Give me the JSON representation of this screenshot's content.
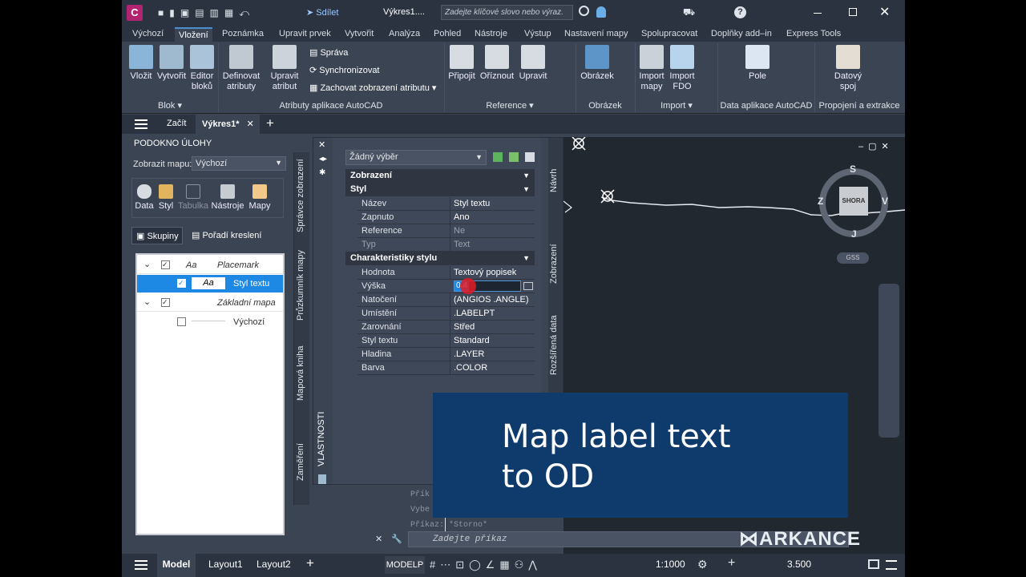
{
  "titlebar": {
    "app_letter": "C",
    "share_label": "Sdílet",
    "doc_title": "Výkres1....",
    "search_placeholder": "Zadejte klíčové slovo nebo výraz."
  },
  "ribbon_tabs": [
    "Výchozí",
    "Vložení",
    "Poznámka",
    "Upravit prvek",
    "Vytvořit",
    "Analýza",
    "Pohled",
    "Nástroje",
    "Výstup",
    "Nastavení mapy",
    "Spolupracovat",
    "Doplňky add–in",
    "Express Tools"
  ],
  "ribbon": {
    "blok": {
      "vlozit": "Vložit",
      "vytvorit": "Vytvořit",
      "editor": "Editor bloků",
      "label": "Blok"
    },
    "atributy": {
      "definovat": "Definovat atributy",
      "upravit": "Upravit atribut",
      "sprava": "Správa",
      "synchronizovat": "Synchronizovat",
      "zachovat": "Zachovat zobrazení atributu",
      "label": "Atributy aplikace AutoCAD"
    },
    "reference": {
      "pripojit": "Připojit",
      "oriznout": "Oříznout",
      "upravit": "Upravit",
      "label": "Reference"
    },
    "obrazek": {
      "obrazek": "Obrázek",
      "label": "Obrázek"
    },
    "import": {
      "import_mapy": "Import mapy",
      "import_fdo": "Import FDO",
      "label": "Import"
    },
    "data": {
      "pole": "Pole",
      "label": "Data aplikace AutoCAD"
    },
    "propojeni": {
      "spoj": "Datový spoj",
      "label": "Propojení a extrakce"
    }
  },
  "doc_tabs": {
    "zacit": "Začít",
    "active": "Výkres1*"
  },
  "task_pane": {
    "title": "PODOKNO ÚLOHY",
    "map_label": "Zobrazit mapu:",
    "map_value": "Výchozí",
    "tools": [
      "Data",
      "Styl",
      "Tabulka",
      "Nástroje",
      "Mapy"
    ],
    "skupiny": "Skupiny",
    "poradi": "Pořadí kreslení",
    "tree": [
      {
        "label": "Placemark",
        "sample": "Aa"
      },
      {
        "label": "Styl textu",
        "sample": "Aa"
      },
      {
        "label": "Základní mapa",
        "sample": ""
      },
      {
        "label": "Výchozí",
        "sample": ""
      }
    ],
    "side_tabs": [
      "Správce zobrazení",
      "Průzkumník mapy",
      "Mapová kniha",
      "Zaměření"
    ]
  },
  "properties": {
    "selection": "Žádný výběr",
    "vertical_title": "VLASTNOSTI",
    "sections": {
      "zobrazeni": "Zobrazení",
      "styl": "Styl",
      "charakteristiky": "Charakteristiky stylu"
    },
    "styl_rows": [
      {
        "k": "Název",
        "v": "Styl textu"
      },
      {
        "k": "Zapnuto",
        "v": "Ano"
      },
      {
        "k": "Reference",
        "v": "Ne"
      },
      {
        "k": "Typ",
        "v": "Text"
      }
    ],
    "char_rows": [
      {
        "k": "Hodnota",
        "v": "Textový popisek"
      },
      {
        "k": "Výška",
        "v": "0.4"
      },
      {
        "k": "Natočení",
        "v": "(ANGIOS .ANGLE)"
      },
      {
        "k": "Umístění",
        "v": ".LABELPT"
      },
      {
        "k": "Zarovnání",
        "v": "Střed"
      },
      {
        "k": "Styl textu",
        "v": "Standard"
      },
      {
        "k": "Hladina",
        "v": ".LAYER"
      },
      {
        "k": "Barva",
        "v": ".COLOR"
      }
    ],
    "right_tabs": [
      "Návrh",
      "Zobrazení",
      "Rozšířená data"
    ]
  },
  "canvas": {
    "compass": {
      "n": "S",
      "s": "J",
      "w": "Z",
      "e": "V",
      "cube": "SHORA",
      "gss": "GSS"
    }
  },
  "command": {
    "history": [
      "Přík",
      "Vybe",
      "Příkaz: *Storno*"
    ],
    "placeholder": "Zadejte příkaz"
  },
  "overlay": {
    "line1": "Map label text",
    "line2": "to OD"
  },
  "brand": "ARKANCE",
  "status": {
    "model": "Model",
    "layout1": "Layout1",
    "layout2": "Layout2",
    "modelp": "MODELP",
    "scale": "1:1000",
    "value": "3.500"
  },
  "colors": {
    "accent": "#1e88e5",
    "overlay": "#0e3a6c",
    "cursor": "#e31b23"
  }
}
